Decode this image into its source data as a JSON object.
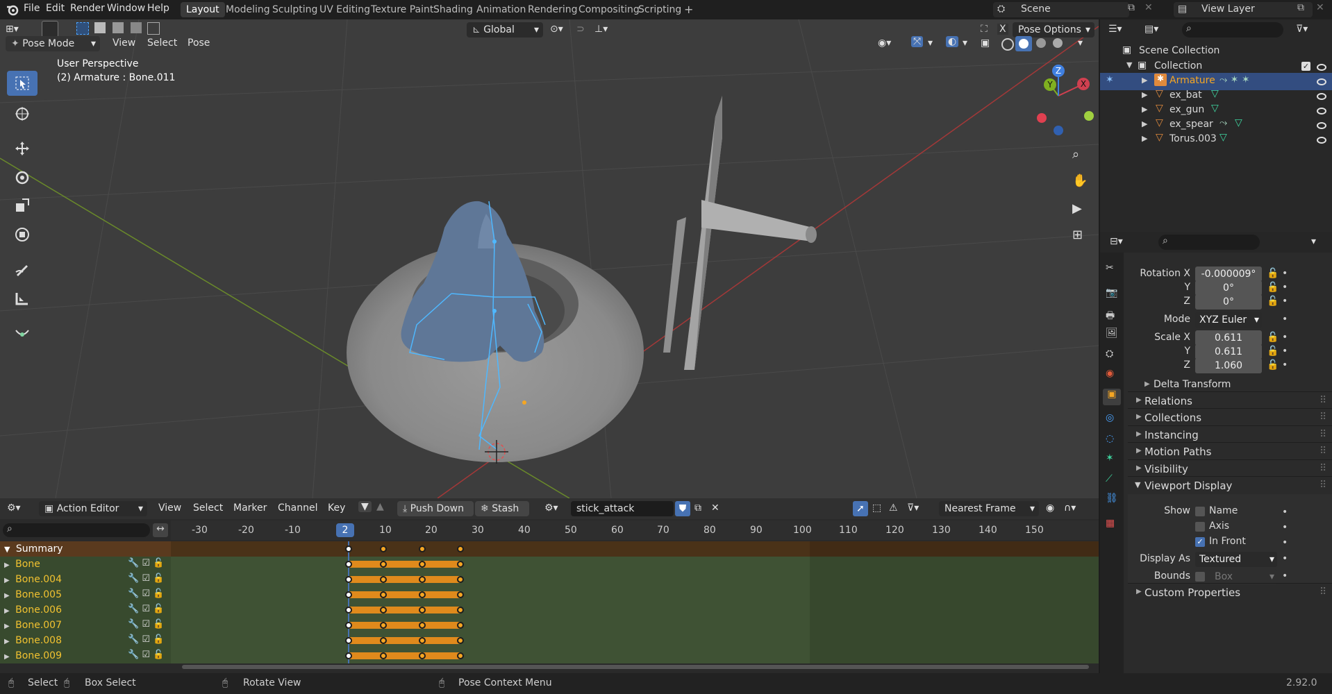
{
  "topbar": {
    "menus": [
      "File",
      "Edit",
      "Render",
      "Window",
      "Help"
    ],
    "workspaces": [
      "Layout",
      "Modeling",
      "Sculpting",
      "UV Editing",
      "Texture Paint",
      "Shading",
      "Animation",
      "Rendering",
      "Compositing",
      "Scripting"
    ],
    "active_workspace": "Layout",
    "add_tab": "+",
    "scene": "Scene",
    "view_layer": "View Layer"
  },
  "viewport": {
    "transform_orientation": "Global",
    "pose_options": "Pose Options",
    "mode": "Pose Mode",
    "header_menus": [
      "View",
      "Select",
      "Pose"
    ],
    "overlay_title": "User Perspective",
    "overlay_subtitle": "(2) Armature : Bone.011",
    "gizmo_x": "X",
    "gizmo_y": "Y",
    "gizmo_z": "Z"
  },
  "outliner": {
    "scene_collection": "Scene Collection",
    "collection": "Collection",
    "items": [
      {
        "name": "Armature",
        "selected": true
      },
      {
        "name": "ex_bat",
        "selected": false
      },
      {
        "name": "ex_gun",
        "selected": false
      },
      {
        "name": "ex_spear",
        "selected": false
      },
      {
        "name": "Torus.003",
        "selected": false
      }
    ]
  },
  "properties": {
    "rotation_label": "Rotation X",
    "rotation_x": "-0.000009°",
    "rotation_y": "0°",
    "rotation_z": "0°",
    "y_label": "Y",
    "z_label": "Z",
    "mode_label": "Mode",
    "mode_value": "XYZ Euler",
    "scale_label": "Scale X",
    "scale_x": "0.611",
    "scale_y": "0.611",
    "scale_z": "1.060",
    "sections": [
      "Delta Transform",
      "Relations",
      "Collections",
      "Instancing",
      "Motion Paths",
      "Visibility"
    ],
    "viewport_display": "Viewport Display",
    "show_label": "Show",
    "show_name": "Name",
    "show_axis": "Axis",
    "show_in_front": "In Front",
    "display_as_label": "Display As",
    "display_as_value": "Textured",
    "bounds_label": "Bounds",
    "bounds_value": "Box",
    "custom_properties": "Custom Properties"
  },
  "action_editor": {
    "editor_type": "Action Editor",
    "menus": [
      "View",
      "Select",
      "Marker",
      "Channel",
      "Key"
    ],
    "push_down": "Push Down",
    "stash": "Stash",
    "action_name": "stick_attack",
    "snap": "Nearest Frame",
    "current_frame": "2",
    "ruler": [
      "-30",
      "-20",
      "-10",
      "10",
      "20",
      "30",
      "40",
      "50",
      "60",
      "70",
      "80",
      "90",
      "100",
      "110",
      "120",
      "130",
      "140",
      "150"
    ],
    "summary": "Summary",
    "channels": [
      "Bone",
      "Bone.004",
      "Bone.005",
      "Bone.006",
      "Bone.007",
      "Bone.008",
      "Bone.009"
    ],
    "keyframes": [
      1,
      10,
      20,
      30
    ]
  },
  "statusbar": {
    "select": "Select",
    "box_select": "Box Select",
    "rotate_view": "Rotate View",
    "context_menu": "Pose Context Menu",
    "version": "2.92.0"
  },
  "colors": {
    "accent": "#4772b3",
    "keyframe": "#f5a623",
    "selected_text": "#f5a623"
  }
}
